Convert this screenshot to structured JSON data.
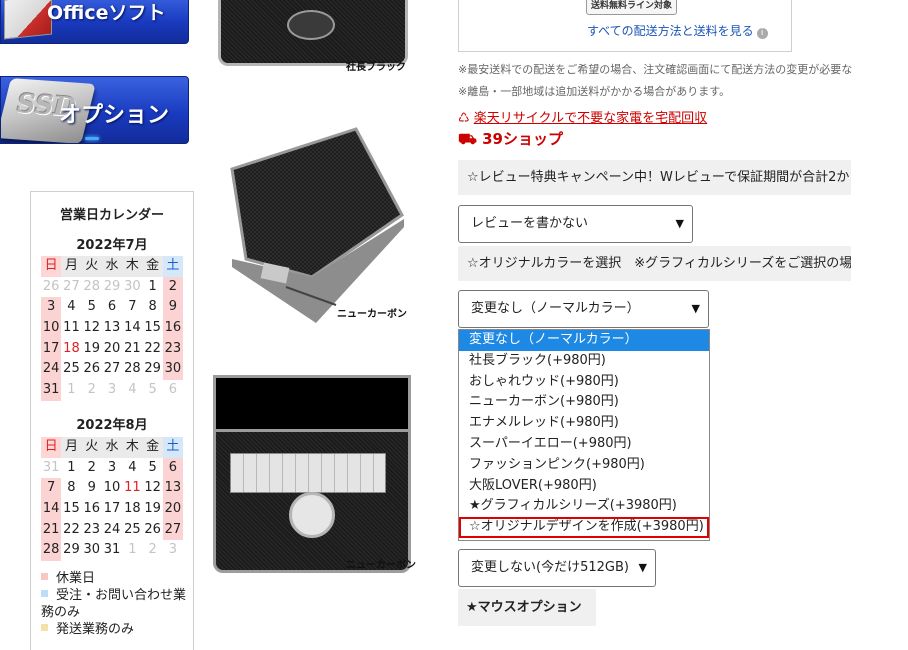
{
  "left_banners": {
    "office_label": "Officeソフト",
    "option_label": "オプション",
    "ssd_label": "SSD"
  },
  "calendar": {
    "title": "営業日カレンダー",
    "weekdays": [
      "日",
      "月",
      "火",
      "水",
      "木",
      "金",
      "土"
    ],
    "months": [
      {
        "title": "2022年7月",
        "days": [
          "26",
          "27",
          "28",
          "29",
          "30",
          "1",
          "2",
          "3",
          "4",
          "5",
          "6",
          "7",
          "8",
          "9",
          "10",
          "11",
          "12",
          "13",
          "14",
          "15",
          "16",
          "17",
          "18",
          "19",
          "20",
          "21",
          "22",
          "23",
          "24",
          "25",
          "26",
          "27",
          "28",
          "29",
          "30",
          "31",
          "1",
          "2",
          "3",
          "4",
          "5",
          "6"
        ]
      },
      {
        "title": "2022年8月",
        "days": [
          "31",
          "1",
          "2",
          "3",
          "4",
          "5",
          "6",
          "7",
          "8",
          "9",
          "10",
          "11",
          "12",
          "13",
          "14",
          "15",
          "16",
          "17",
          "18",
          "19",
          "20",
          "21",
          "22",
          "23",
          "24",
          "25",
          "26",
          "27",
          "28",
          "29",
          "30",
          "31",
          "1",
          "2",
          "3"
        ]
      }
    ],
    "legend": [
      {
        "label": "休業日",
        "color": "#f9c6c6"
      },
      {
        "label": "受注・お問い合わせ業務のみ",
        "color": "#bcdcf7"
      },
      {
        "label": "発送業務のみ",
        "color": "#f4e0a8"
      }
    ]
  },
  "product_images": {
    "caption_1": "社長ブラック",
    "caption_2": "ニューカーボン",
    "caption_3": "ニューカーボン"
  },
  "shipping": {
    "free_badge": "送料無料ライン対象",
    "link_text": "すべての配送方法と送料を見る",
    "info_icon": "i",
    "note_1": "※最安送料での配送をご希望の場合、注文確認画面にて配送方法の変更が必要な",
    "note_2": "※離島・一部地域は追加送料がかかる場合があります。",
    "recycle_link": "楽天リサイクルで不要な家電を宅配回収",
    "shop39": "39ショップ"
  },
  "review": {
    "heading": "☆レビュー特典キャンペーン中！Wレビューで保証期間が合計2か",
    "select_value": "レビューを書かない"
  },
  "color_option": {
    "heading": "☆オリジナルカラーを選択　※グラフィカルシリーズをご選択の場",
    "select_value": "変更なし（ノーマルカラー）",
    "options": [
      "変更なし（ノーマルカラー）",
      "社長ブラック(+980円)",
      "おしゃれウッド(+980円)",
      "ニューカーボン(+980円)",
      "エナメルレッド(+980円)",
      "スーパーイエロー(+980円)",
      "ファッションピンク(+980円)",
      "大阪LOVER(+980円)",
      "★グラフィカルシリーズ(+3980円)",
      "☆オリジナルデザインを作成(+3980円)"
    ],
    "selected_index": 0,
    "highlighted_index": 9
  },
  "storage": {
    "select_value": "変更しない(今だけ512GB)"
  },
  "mouse": {
    "heading": "★マウスオプション"
  },
  "colors": {
    "banner_blue": "#1a3bc0",
    "accent_red": "#cc0000",
    "link_blue": "#1a55b8",
    "selection_blue": "#1e88e5"
  }
}
